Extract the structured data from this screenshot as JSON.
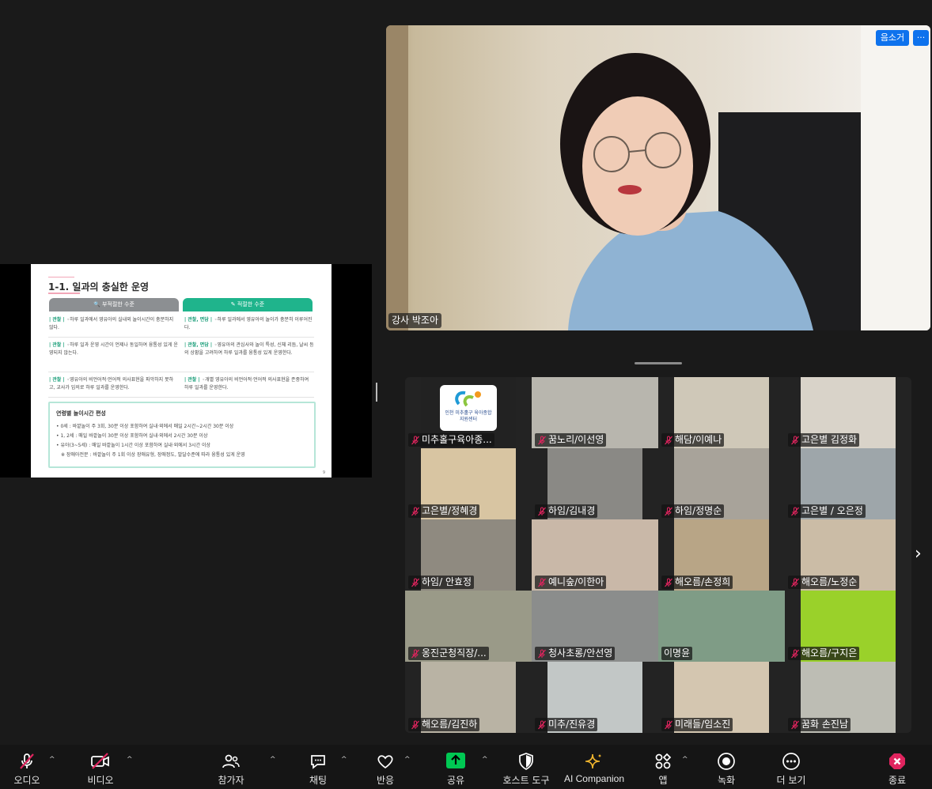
{
  "slide": {
    "title": "1-1. 일과의 충실한 운영",
    "head_bad": "🔍 부적절한 수준",
    "head_good": "✎ 적절한 수준",
    "rows": [
      {
        "bad_tag": "| 관찰 |",
        "bad_text": "◦하루 일과에서 영유아의 실내외 놀이시간이 충분하지 않다.",
        "good_tag": "| 관찰, 면담 |",
        "good_text": "◦하루 일과에서 영유아의 놀이가 충분히 이루어진다."
      },
      {
        "bad_tag": "| 관찰 |",
        "bad_text": "◦하루 일과 운영 시간이 언제나 동일하여 융통성 있게 운영되지 않는다.",
        "good_tag": "| 관찰, 면담 |",
        "good_text": "◦영유아의 관심사와 놀이 특성, 신체 리듬, 날씨 등의 상황을 고려하여 하루 일과를 융통성 있게 운영한다."
      },
      {
        "bad_tag": "| 관찰 |",
        "bad_text": "◦영유아의 비언어적·언어적 의사표현을 파악하지 못하고, 교사가 임의로 하루 일과를 운영한다.",
        "good_tag": "| 관찰 |",
        "good_text": "◦개별 영유아의 비언어적·언어적 의사표현을 존중하여 하루 일과를 운영한다."
      }
    ],
    "box_title": "연령별 놀이시간 편성",
    "box_lines": [
      "• 0세 : 바깥놀이 주 3회, 30분 이상 포함하여 실내·외에서 매일 2시간~2시간 30분 이상",
      "• 1, 2세 : 매일 바깥놀이 30분 이상 포함하여 실내·외에서 2시간 30분 이상",
      "• 유아(3~5세) : 매일 바깥놀이 1시간 이상 포함하여 실내·외에서 3시간 이상",
      "※ 장애아전문 : 바깥놀이 주 1회 이상 장애유형, 장애정도, 발달수준에 따라 융통성 있게 운영"
    ],
    "page_no": "9"
  },
  "speaker": {
    "name": "강사 박조아",
    "mute_all_label": "음소거",
    "more_label": "···"
  },
  "gallery": {
    "participants": [
      {
        "name": "미추홀구육아종...",
        "muted": true,
        "bg": "#222222",
        "logo": true
      },
      {
        "name": "꿈노리/이선영",
        "muted": true,
        "bg": "#b8b6ae"
      },
      {
        "name": "해담/이예나",
        "muted": true,
        "bg": "#cfc8b8"
      },
      {
        "name": "고은별 김정화",
        "muted": true,
        "bg": "#d9d3c9"
      },
      {
        "name": "고은별/정혜경",
        "muted": true,
        "bg": "#d8c5a2"
      },
      {
        "name": "하임/김내경",
        "muted": true,
        "bg": "#8a8985"
      },
      {
        "name": "하임/정명순",
        "muted": true,
        "bg": "#a8a39a"
      },
      {
        "name": "고은별 / 오은정",
        "muted": true,
        "bg": "#9ea6aa"
      },
      {
        "name": "하임/ 안효정",
        "muted": true,
        "bg": "#8f8a80"
      },
      {
        "name": "예니숲/이한아",
        "muted": true,
        "bg": "#c9b8a8"
      },
      {
        "name": "해오름/손정희",
        "muted": true,
        "bg": "#b8a586"
      },
      {
        "name": "해오름/노정순",
        "muted": true,
        "bg": "#cbbca6"
      },
      {
        "name": "옹진군청직장/...",
        "muted": true,
        "bg": "#9a9a88"
      },
      {
        "name": "청사초롱/안선영",
        "muted": true,
        "bg": "#8b8d8c"
      },
      {
        "name": "이명윤",
        "muted": false,
        "bg": "#7f9c86"
      },
      {
        "name": "해오름/구지은",
        "muted": true,
        "bg": "#9ad12a"
      },
      {
        "name": "해오름/김진하",
        "muted": true,
        "bg": "#b9b3a4"
      },
      {
        "name": "미추/진유경",
        "muted": true,
        "bg": "#c2c7c6"
      },
      {
        "name": "미래들/임소진",
        "muted": true,
        "bg": "#d4c6b0"
      },
      {
        "name": "꿈화 손진남",
        "muted": true,
        "bg": "#bdbdb4"
      }
    ],
    "logo_caption": "인천 미추홀구 육아종합지원센터"
  },
  "toolbar": {
    "audio": "오디오",
    "video": "비디오",
    "participants": "참가자",
    "chat": "채팅",
    "reactions": "반응",
    "share": "공유",
    "host_tools": "호스트 도구",
    "ai_companion": "AI Companion",
    "apps": "앱",
    "record": "녹화",
    "more": "더 보기",
    "end": "종료"
  },
  "colors": {
    "accent_blue": "#0e72ed",
    "share_green": "#00c853",
    "muted_red": "#e0245e",
    "slide_green": "#1fb48c"
  }
}
